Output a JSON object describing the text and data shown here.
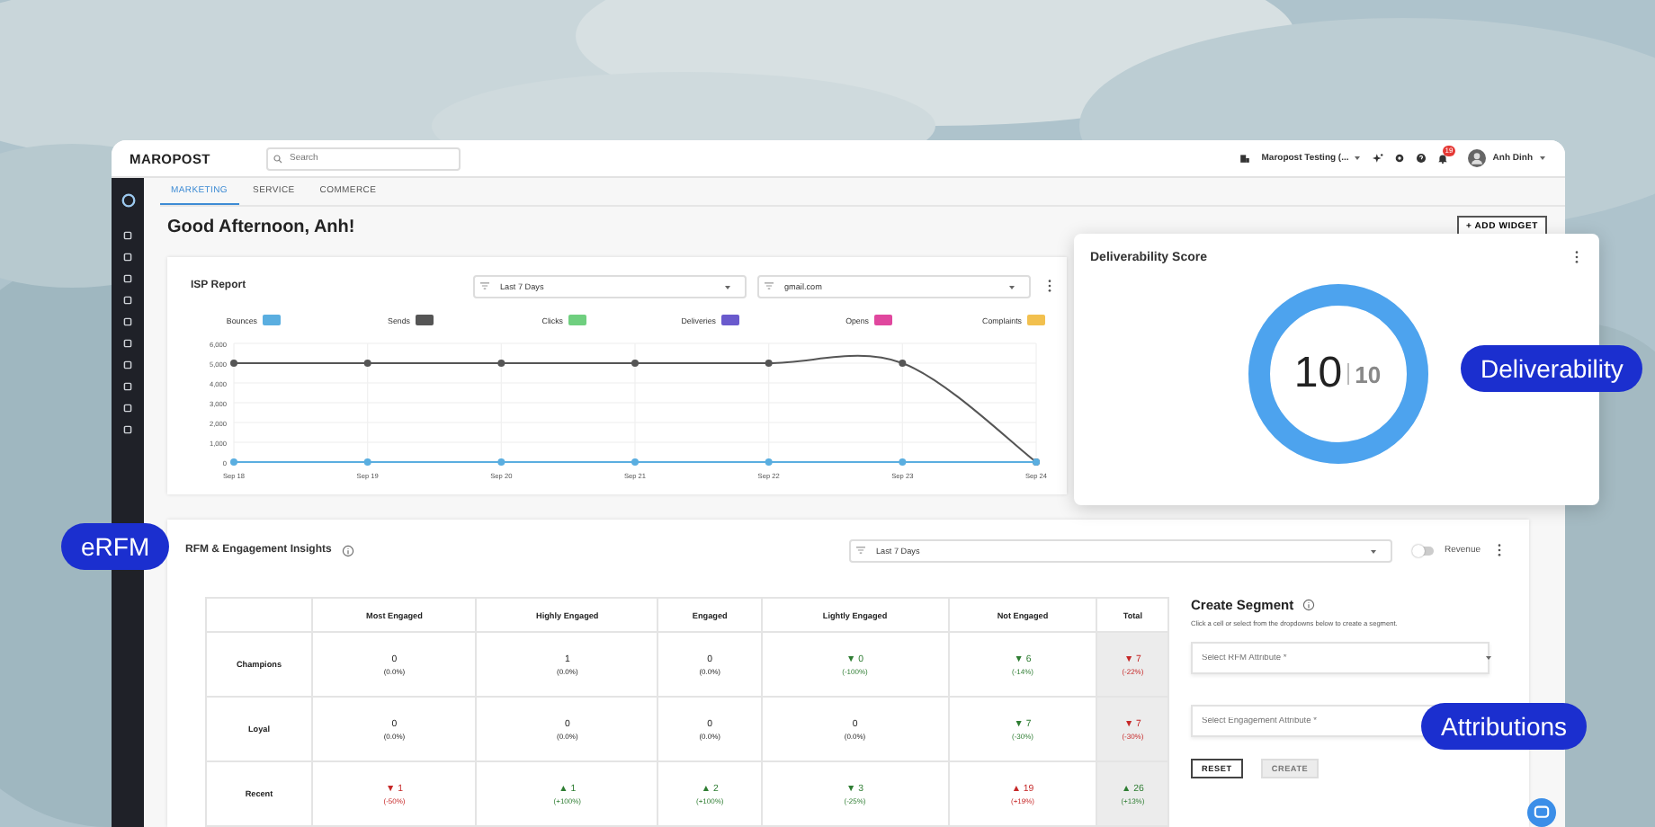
{
  "header": {
    "logo": "MAROPOST",
    "search": {
      "placeholder": "Search"
    },
    "account": "Maropost Testing (...",
    "notifications": "19",
    "user": "Anh Dinh"
  },
  "tabs": [
    {
      "label": "MARKETING",
      "selected": true
    },
    {
      "label": "SERVICE",
      "selected": false
    },
    {
      "label": "COMMERCE",
      "selected": false
    }
  ],
  "greeting": "Good Afternoon, Anh!",
  "add_widget": "+ ADD WIDGET",
  "isp_report": {
    "title": "ISP Report",
    "period": "Last 7 Days",
    "domain": "gmail.com",
    "chart_data": {
      "type": "line",
      "grid": true,
      "legend": "top",
      "categories": [
        "Sep 18",
        "Sep 19",
        "Sep 20",
        "Sep 21",
        "Sep 22",
        "Sep 23",
        "Sep 24"
      ],
      "ylim": [
        0,
        6000
      ],
      "yticks": [
        {
          "value": 0,
          "label": "0"
        },
        {
          "value": 1000,
          "label": "1,000"
        },
        {
          "value": 2000,
          "label": "2,000"
        },
        {
          "value": 3000,
          "label": "3,000"
        },
        {
          "value": 4000,
          "label": "4,000"
        },
        {
          "value": 5000,
          "label": "5,000"
        },
        {
          "value": 6000,
          "label": "6,000"
        }
      ],
      "series": [
        {
          "name": "Bounces",
          "color": "#5aaee0",
          "marker": true,
          "values": [
            0,
            0,
            0,
            0,
            0,
            0,
            0
          ]
        },
        {
          "name": "Sends",
          "color": "#555555",
          "marker": true,
          "values": [
            5000,
            5000,
            5000,
            5000,
            5000,
            5000,
            0
          ]
        },
        {
          "name": "Clicks",
          "color": "#6fcf7f",
          "values": [
            null,
            null,
            null,
            null,
            null,
            null,
            null
          ]
        },
        {
          "name": "Deliveries",
          "color": "#6a5acd",
          "values": [
            null,
            null,
            null,
            null,
            null,
            null,
            null
          ]
        },
        {
          "name": "Opens",
          "color": "#e0479e",
          "values": [
            null,
            null,
            null,
            null,
            null,
            null,
            null
          ]
        },
        {
          "name": "Complaints",
          "color": "#f2c04e",
          "values": [
            null,
            null,
            null,
            null,
            null,
            null,
            null
          ]
        }
      ]
    }
  },
  "deliverability": {
    "title": "Deliverability Score",
    "score": "10",
    "max": "10",
    "level": 1
  },
  "callouts": [
    {
      "label": "Deliverability",
      "kind": "right"
    },
    {
      "label": "eRFM",
      "kind": "left"
    },
    {
      "label": "Attributions",
      "kind": "bottom"
    }
  ],
  "rfm": {
    "title": "RFM & Engagement Insights",
    "period": "Last 7 Days",
    "revenue": {
      "label": "Revenue",
      "on": false
    },
    "columns": [
      "Most Engaged",
      "Highly Engaged",
      "Engaged",
      "Lightly Engaged",
      "Not Engaged",
      "Total"
    ],
    "rows": [
      {
        "label": "Champions",
        "cells": [
          {
            "value": "0",
            "change": "(0.0%)"
          },
          {
            "value": "1",
            "change": "(0.0%)"
          },
          {
            "value": "0",
            "change": "(0.0%)"
          },
          {
            "value": "▼ 0",
            "change": "(-100%)",
            "color": "#2e7d32"
          },
          {
            "value": "▼ 6",
            "change": "(-14%)",
            "color": "#2e7d32"
          },
          {
            "value": "▼ 7",
            "change": "(-22%)",
            "color": "#c62828"
          }
        ]
      },
      {
        "label": "Loyal",
        "cells": [
          {
            "value": "0",
            "change": "(0.0%)"
          },
          {
            "value": "0",
            "change": "(0.0%)"
          },
          {
            "value": "0",
            "change": "(0.0%)"
          },
          {
            "value": "0",
            "change": "(0.0%)"
          },
          {
            "value": "▼ 7",
            "change": "(-30%)",
            "color": "#2e7d32"
          },
          {
            "value": "▼ 7",
            "change": "(-30%)",
            "color": "#c62828"
          }
        ]
      },
      {
        "label": "Recent",
        "cells": [
          {
            "value": "▼ 1",
            "change": "(-50%)",
            "color": "#c62828"
          },
          {
            "value": "▲ 1",
            "change": "(+100%)",
            "color": "#2e7d32"
          },
          {
            "value": "▲ 2",
            "change": "(+100%)",
            "color": "#2e7d32"
          },
          {
            "value": "▼ 3",
            "change": "(-25%)",
            "color": "#2e7d32"
          },
          {
            "value": "▲ 19",
            "change": "(+19%)",
            "color": "#c62828"
          },
          {
            "value": "▲ 26",
            "change": "(+13%)",
            "color": "#2e7d32"
          }
        ]
      }
    ]
  },
  "create_segment": {
    "title": "Create Segment",
    "hint": "Click a cell or select from the dropdowns below to create a segment.",
    "rfm_select": {
      "placeholder": "Select RFM Attribute *"
    },
    "engagement_select": {
      "placeholder": "Select Engagement Attribute *"
    },
    "buttons": [
      {
        "label": "RESET",
        "disabled": false
      },
      {
        "label": "CREATE",
        "disabled": true
      }
    ]
  }
}
